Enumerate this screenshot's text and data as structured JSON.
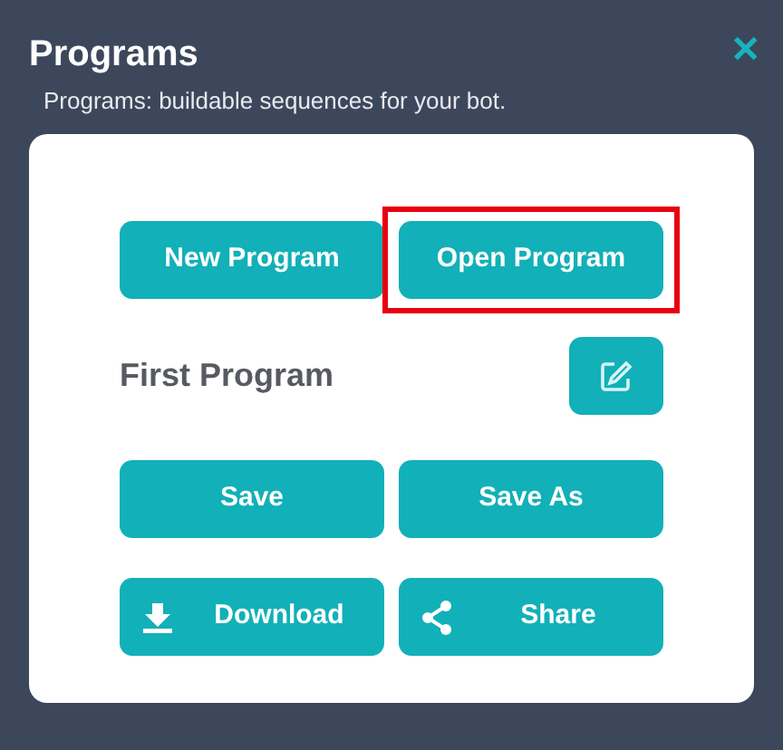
{
  "header": {
    "title": "Programs",
    "subtitle": "Programs: buildable sequences for your bot.",
    "close": "✕"
  },
  "top_buttons": [
    {
      "label": "New Program",
      "highlighted": false
    },
    {
      "label": "Open Program",
      "highlighted": true
    }
  ],
  "program": {
    "name": "First Program"
  },
  "action_buttons": [
    {
      "label": "Save",
      "kind": "plain"
    },
    {
      "label": "Save As",
      "kind": "plain"
    },
    {
      "label": "Download",
      "kind": "download"
    },
    {
      "label": "Share",
      "kind": "share"
    }
  ]
}
